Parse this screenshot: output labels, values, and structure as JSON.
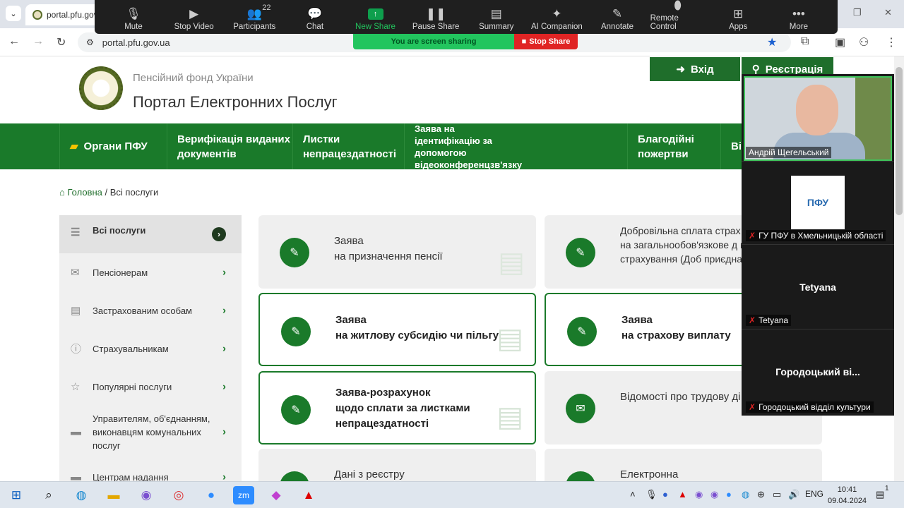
{
  "browser": {
    "tab_title": "portal.pfu.gov",
    "url": "portal.pfu.gov.ua"
  },
  "zoom": {
    "controls": [
      {
        "label": "Mute",
        "icon": "microphone-icon"
      },
      {
        "label": "Stop Video",
        "icon": "video-icon"
      },
      {
        "label": "Participants",
        "icon": "participants-icon",
        "count": "22"
      },
      {
        "label": "Chat",
        "icon": "chat-icon"
      },
      {
        "label": "New Share",
        "icon": "share-icon"
      },
      {
        "label": "Pause Share",
        "icon": "pause-icon"
      },
      {
        "label": "Summary",
        "icon": "summary-icon"
      },
      {
        "label": "AI Companion",
        "icon": "sparkle-icon"
      },
      {
        "label": "Annotate",
        "icon": "pencil-icon"
      },
      {
        "label": "Remote Control",
        "icon": "mouse-icon"
      },
      {
        "label": "Apps",
        "icon": "apps-icon"
      },
      {
        "label": "More",
        "icon": "more-icon"
      }
    ],
    "sharing_text": "You are screen sharing",
    "stop_share": "Stop Share",
    "participants": [
      {
        "name": "Андрій Щегельський"
      },
      {
        "name": "ГУ ПФУ в Хмельницькій області",
        "logo_text": "ПФУ"
      },
      {
        "name": "Tetyana",
        "display": "Tetyana"
      },
      {
        "name": "Городоцький відділ культури",
        "display": "Городоцький ві..."
      }
    ]
  },
  "site": {
    "org_name": "Пенсійний фонд України",
    "portal_title": "Портал Електронних Послуг",
    "login": "Вхід",
    "register": "Реєстрація",
    "nav": [
      {
        "label": "Органи ПФУ"
      },
      {
        "label": "Верифікація виданих документів"
      },
      {
        "label": "Листки непрацездатності"
      },
      {
        "label": "Заява на ідентифікацію за допомогою відеоконференцзв'язку"
      },
      {
        "label": "Благодійні пожертви"
      },
      {
        "label": "Ві"
      }
    ],
    "breadcrumb": {
      "home": "Головна",
      "sep": " / ",
      "current": "Всі послуги"
    },
    "sidebar": [
      {
        "label": "Всі послуги"
      },
      {
        "label": "Пенсіонерам"
      },
      {
        "label": "Застрахованим особам"
      },
      {
        "label": "Страхувальникам"
      },
      {
        "label": "Популярні послуги"
      },
      {
        "label": "Управителям, об'єднанням, виконавцям комунальних послуг"
      },
      {
        "label": "Центрам надання"
      }
    ],
    "cards": [
      {
        "title": "Заява",
        "subtitle": "на призначення пенсії"
      },
      {
        "title": "Добровільна сплата страх",
        "subtitle": "на загальнообов'язкове д пенсійне страхування (Доб приєднання)"
      },
      {
        "title": "Заява",
        "subtitle": "на житлову субсидію чи пільгу"
      },
      {
        "title": "Заява",
        "subtitle": "на страхову виплату"
      },
      {
        "title": "Заява-розрахунок",
        "subtitle": "щодо сплати за листками непрацездатності"
      },
      {
        "title": "Відомості про трудову ді",
        "subtitle": ""
      },
      {
        "title": "Дані з реєстру",
        "subtitle": ""
      },
      {
        "title": "Електронна",
        "subtitle": ""
      }
    ]
  },
  "taskbar": {
    "lang": "ENG",
    "time": "10:41",
    "date": "09.04.2024",
    "notif": "1"
  }
}
